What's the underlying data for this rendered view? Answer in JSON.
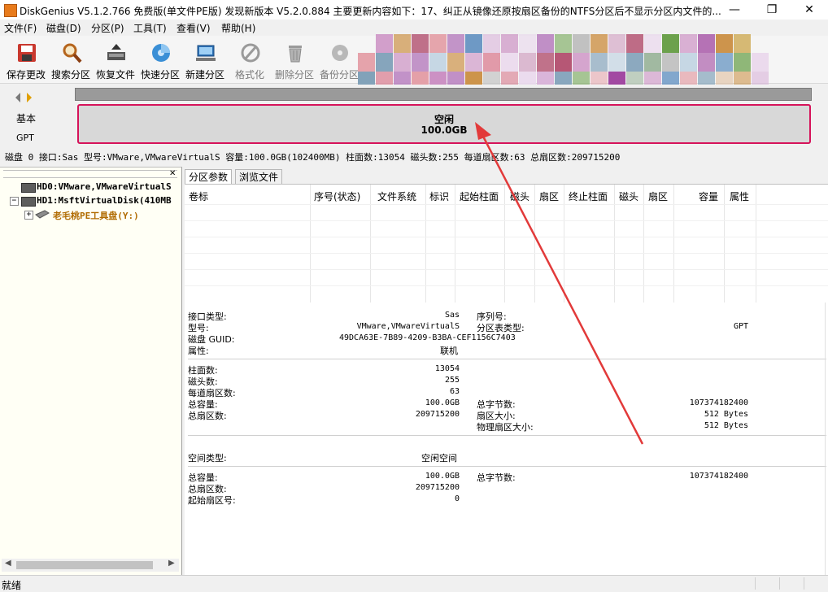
{
  "window": {
    "title": "DiskGenius V5.1.2.766 免费版(单文件PE版)   发现新版本 V5.2.0.884 主要更新内容如下：17、纠正从镜像还原按扇区备份的NTFS分区后不显示分区内文件的..."
  },
  "menu": [
    "文件(F)",
    "磁盘(D)",
    "分区(P)",
    "工具(T)",
    "查看(V)",
    "帮助(H)"
  ],
  "toolbar": {
    "save": "保存更改",
    "search": "搜索分区",
    "recover": "恢复文件",
    "quick_partition": "快速分区",
    "new_partition": "新建分区",
    "format": "格式化",
    "delete": "删除分区",
    "backup": "备份分区"
  },
  "disk_map": {
    "style": "基本",
    "table_type": "GPT",
    "free_label": "空闲",
    "free_size": "100.0GB"
  },
  "disk_info": "磁盘 0 接口:Sas  型号:VMware,VMwareVirtualS  容量:100.0GB(102400MB)  柱面数:13054  磁头数:255  每道扇区数:63  总扇区数:209715200",
  "tree": {
    "hd0": "HD0:VMware,VMwareVirtualS",
    "hd1": "HD1:MsftVirtualDisk(410MB",
    "volume": "老毛桃PE工具盘(Y:)"
  },
  "tabs": [
    "分区参数",
    "浏览文件"
  ],
  "table_headers": [
    "卷标",
    "序号(状态)",
    "文件系统",
    "标识",
    "起始柱面",
    "磁头",
    "扇区",
    "终止柱面",
    "磁头",
    "扇区",
    "容量",
    "属性"
  ],
  "details": {
    "interface_type_label": "接口类型:",
    "interface_type": "Sas",
    "model_label": "型号:",
    "model": "VMware,VMwareVirtualS",
    "guid_label": "磁盘 GUID:",
    "guid": "49DCA63E-7B89-4209-B3BA-CEF1156C7403",
    "attr_label": "属性:",
    "attr": "联机",
    "serial_label": "序列号:",
    "pt_type_label": "分区表类型:",
    "pt_type": "GPT",
    "cyl_label": "柱面数:",
    "cyl": "13054",
    "heads_label": "磁头数:",
    "heads": "255",
    "spt_label": "每道扇区数:",
    "spt": "63",
    "cap_label": "总容量:",
    "cap": "100.0GB",
    "sectors_label": "总扇区数:",
    "sectors": "209715200",
    "bytes_label": "总字节数:",
    "bytes": "107374182400",
    "sector_size_label": "扇区大小:",
    "sector_size": "512 Bytes",
    "phys_sector_label": "物理扇区大小:",
    "phys_sector": "512 Bytes",
    "space_type_label": "空间类型:",
    "space_type": "空闲空间",
    "free_cap_label": "总容量:",
    "free_cap": "100.0GB",
    "free_bytes_label": "总字节数:",
    "free_bytes": "107374182400",
    "free_sectors_label": "总扇区数:",
    "free_sectors": "209715200",
    "start_sector_label": "起始扇区号:",
    "start_sector": "0"
  },
  "status": "就绪",
  "colors": {
    "highlight": "#d6135a",
    "tree_bg": "#fffff5"
  }
}
